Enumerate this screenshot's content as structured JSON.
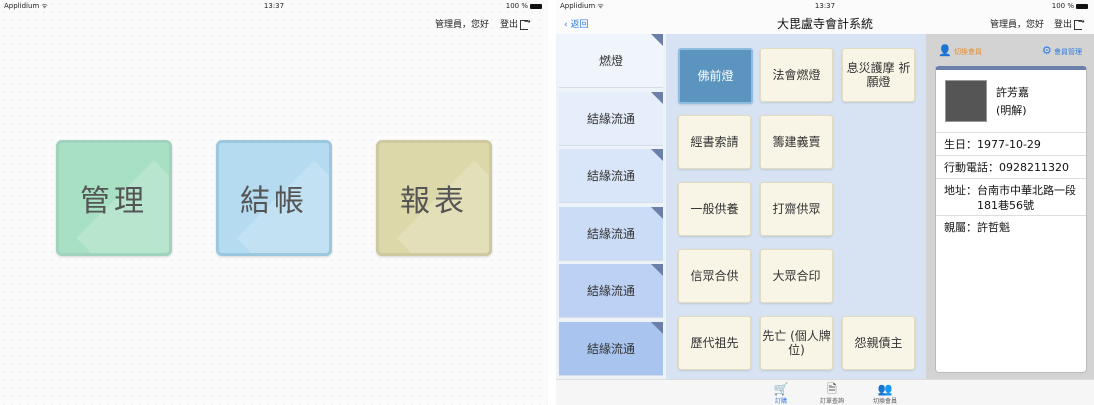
{
  "left_screen": {
    "status": {
      "carrier": "Applidium ᯤ",
      "time": "13:37",
      "battery": "100 %"
    },
    "user_text": "管理員，您好",
    "logout_label": "登出",
    "tiles": [
      {
        "label": "管理",
        "bg": "#a8e0c4",
        "border": "#9fd3bd"
      },
      {
        "label": "結帳",
        "bg": "#b5dbf0",
        "border": "#9cc8df"
      },
      {
        "label": "報表",
        "bg": "#ddd8aa",
        "border": "#cfc9a0"
      }
    ]
  },
  "right_screen": {
    "status": {
      "carrier": "Applidium ᯤ",
      "time": "13:37",
      "battery": "100 %"
    },
    "nav": {
      "back": "返回",
      "title": "大毘盧寺會計系統",
      "user_text": "管理員，您好",
      "logout_label": "登出"
    },
    "sidebar": [
      {
        "label": "燃燈",
        "bg": "#f0f5fc"
      },
      {
        "label": "結緣流通",
        "bg": "#e6eefb"
      },
      {
        "label": "結緣流通",
        "bg": "#d9e6f9"
      },
      {
        "label": "結緣流通",
        "bg": "#cbdcf6"
      },
      {
        "label": "結緣流通",
        "bg": "#bcd1f3"
      },
      {
        "label": "結緣流通",
        "bg": "#a9c4ef"
      }
    ],
    "grid_buttons": [
      {
        "label": "佛前燈",
        "active": true
      },
      {
        "label": "法會燃燈"
      },
      {
        "label": "息災護摩 祈願燈"
      },
      {
        "label": "經書索請"
      },
      {
        "label": "籌建義賣"
      },
      {
        "label": "一般供養"
      },
      {
        "label": "打齋供眾"
      },
      {
        "label": "信眾合供"
      },
      {
        "label": "大眾合印"
      },
      {
        "label": "歷代祖先"
      },
      {
        "label": "先亡 (個人牌位)"
      },
      {
        "label": "怨親債主"
      }
    ],
    "panel": {
      "switch_member": "切換會員",
      "member_manage": "會員管理",
      "name": "許芳嘉",
      "dharma_name": "(明解)",
      "birthday": "生日：1977-10-29",
      "phone": "行動電話：0928211320",
      "address_line1": "地址：台南市中華北路一段",
      "address_line2": "181巷56號",
      "relatives": "親屬：許哲魁"
    },
    "tabbar": [
      {
        "label": "訂購",
        "icon": "cart-icon"
      },
      {
        "label": "訂單查詢",
        "icon": "document-icon"
      },
      {
        "label": "切換會員",
        "icon": "users-icon"
      }
    ]
  }
}
